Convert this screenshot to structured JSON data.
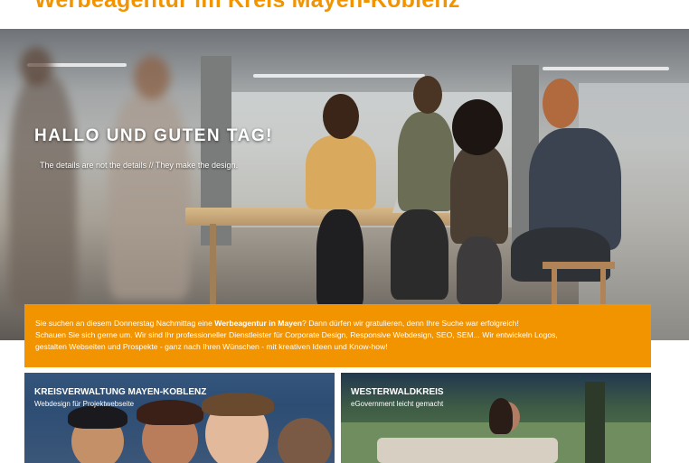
{
  "header": {
    "title": "Werbeagentur im Kreis Mayen-Koblenz"
  },
  "hero": {
    "headline": "HALLO UND GUTEN TAG!",
    "tagline": "The details are not the details // They make the design."
  },
  "intro": {
    "line1_pre": "Sie suchen an diesem Donnerstag Nachmittag eine ",
    "line1_bold": "Werbeagentur in Mayen",
    "line1_post": "? Dann dürfen wir gratulieren, denn Ihre Suche war erfolgreich!",
    "line2": "Schauen Sie sich gerne um. Wir sind Ihr professioneller Dienstleister für Corporate Design, Responsive Webdesign, SEO, SEM... Wir entwickeln Logos,",
    "line3": "gestalten Webseiten und Prospekte - ganz nach Ihren Wünschen - mit kreativen Ideen und Know-how!"
  },
  "tiles": [
    {
      "title": "KREISVERWALTUNG MAYEN-KOBLENZ",
      "subtitle": "Webdesign für Projektwebseite"
    },
    {
      "title": "WESTERWALDKREIS",
      "subtitle": "eGovernment leicht gemacht"
    }
  ],
  "colors": {
    "accent": "#f29400",
    "tile_1_bg": "#2d4d74",
    "tile_2_bg": "#3f5d45",
    "text_on_dark": "#ffffff"
  }
}
